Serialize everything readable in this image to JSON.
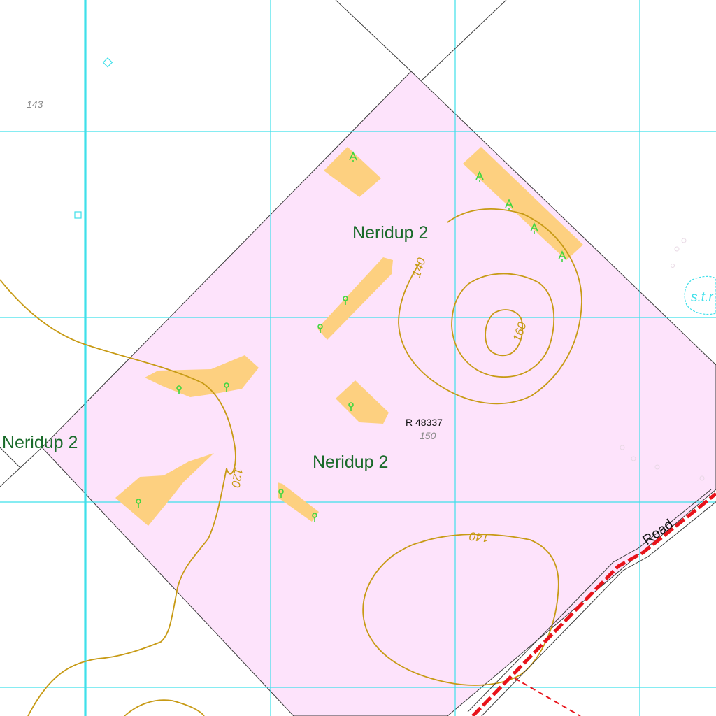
{
  "map": {
    "colors": {
      "background": "#ffffff",
      "reserve_fill": "#fde3fb",
      "grid_line": "#3ee0ea",
      "parcel_line": "#3a3a3a",
      "contour": "#c79a14",
      "vegetation_patch": "#fdd080",
      "tree_symbol": "#3fd640",
      "locality_text": "#1a6b2a",
      "spot_height_text": "#8a8a8a",
      "road_red": "#e8141b",
      "road_casing": "#3a3a3a"
    },
    "locality_labels": [
      "Neridup 2",
      "Neridup 2",
      "Neridup 2"
    ],
    "reserve_label": "R 48337",
    "spot_heights": [
      "143",
      "150"
    ],
    "contour_labels": [
      "140",
      "160",
      "120",
      "140"
    ],
    "road_label": "Road",
    "partial_label": "s.t.r",
    "icons": [
      "tree-symbol",
      "small-square-marker",
      "diamond-marker",
      "circle-markers"
    ]
  }
}
